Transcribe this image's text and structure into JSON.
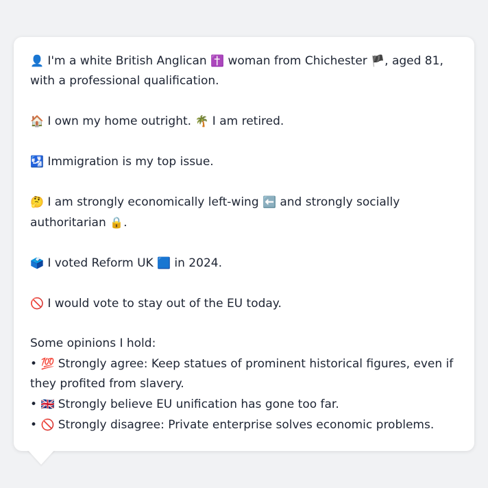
{
  "profile": {
    "identity": {
      "emoji_person": "👤",
      "text_a": "I'm a white British Anglican",
      "emoji_cross": "✝️",
      "text_b": "woman from Chichester",
      "emoji_flag": "🏴",
      "text_c": ", aged 81, with a professional qualification."
    },
    "home": {
      "emoji_house": "🏠",
      "text_a": "I own my home outright.",
      "emoji_palm": "🌴",
      "text_b": "I am retired."
    },
    "issue": {
      "emoji": "🛂",
      "text": "Immigration is my top issue."
    },
    "politics": {
      "emoji_think": "🤔",
      "text_a": "I am strongly economically left-wing",
      "emoji_left": "⬅️",
      "text_b": "and strongly socially authoritarian",
      "emoji_lock": "🔒",
      "text_c": "."
    },
    "vote": {
      "emoji_box": "🗳️",
      "text_a": "I voted Reform UK",
      "emoji_square": "🟦",
      "text_b": "in 2024."
    },
    "eu": {
      "emoji": "🚫",
      "text": "I would vote to stay out of the EU today."
    },
    "opinions": {
      "heading": "Some opinions I hold:",
      "items": [
        {
          "bullet": "•",
          "emoji": "💯",
          "text": "Strongly agree: Keep statues of prominent historical figures, even if they profited from slavery."
        },
        {
          "bullet": "•",
          "emoji": "🇬🇧",
          "text": "Strongly believe EU unification has gone too far."
        },
        {
          "bullet": "•",
          "emoji": "🚫",
          "text": "Strongly disagree: Private enterprise solves economic problems."
        }
      ]
    }
  }
}
